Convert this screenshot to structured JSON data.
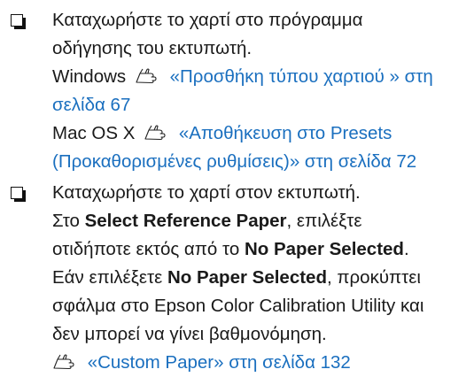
{
  "items": [
    {
      "intro_line1": "Καταχωρήστε το χαρτί στο πρόγραμμα",
      "intro_line2": "οδήγησης του εκτυπωτή.",
      "windows_label": "Windows",
      "windows_link_line1": "«Προσθήκη τύπου χαρτιού » στη",
      "windows_link_line2": "σελίδα 67",
      "mac_label": "Mac OS X",
      "mac_link_line1": "«Αποθήκευση στο Presets",
      "mac_link_line2": "(Προκαθορισμένες ρυθμίσεις)» στη σελίδα 72"
    },
    {
      "intro": "Καταχωρήστε το χαρτί στον εκτυπωτή.",
      "step_prefix": "Στο ",
      "step_bold": "Select Reference Paper",
      "step_suffix": ", επιλέξτε",
      "step_line2_prefix": "οτιδήποτε εκτός από το ",
      "step_line2_bold": "No Paper Selected",
      "step_line2_suffix": ".",
      "warn_prefix": "Εάν επιλέξετε ",
      "warn_bold": "No Paper Selected",
      "warn_suffix": ", προκύπτει",
      "warn_line2": "σφάλμα στο Epson Color Calibration Utility και",
      "warn_line3": "δεν μπορεί να γίνει βαθμονόμηση.",
      "ref_link": "«Custom Paper» στη σελίδα 132"
    }
  ],
  "icons": {
    "checkbox": "checkbox-icon",
    "reference": "pointing-hand-icon"
  },
  "colors": {
    "link": "#1a6fbf",
    "text": "#1a1a1a"
  }
}
